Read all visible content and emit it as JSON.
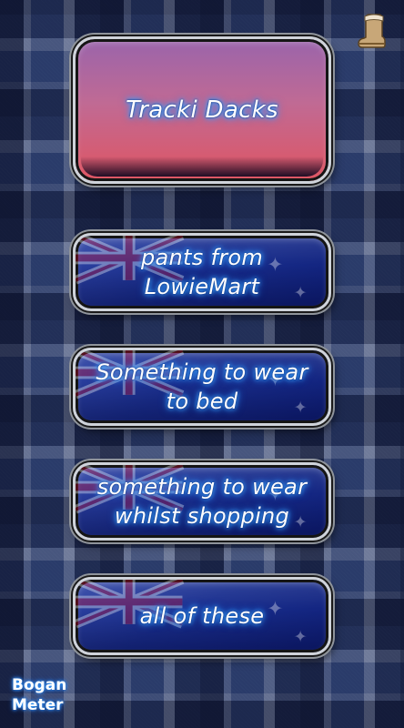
{
  "colors": {
    "main_top": "#9a64ab",
    "main_bottom": "#e05562",
    "answer_blue": "#1a2f8f",
    "label_glow": "#3aa8ff"
  },
  "header": {
    "icon": "ugg-boot-icon"
  },
  "question": {
    "text": "Tracki Dacks"
  },
  "answers": [
    {
      "text": "pants from LowieMart"
    },
    {
      "text": "Something to wear to bed"
    },
    {
      "text": "something to wear whilst shopping"
    },
    {
      "text": "all of these"
    }
  ],
  "footer": {
    "meter_line1": "Bogan",
    "meter_line2": "Meter"
  }
}
